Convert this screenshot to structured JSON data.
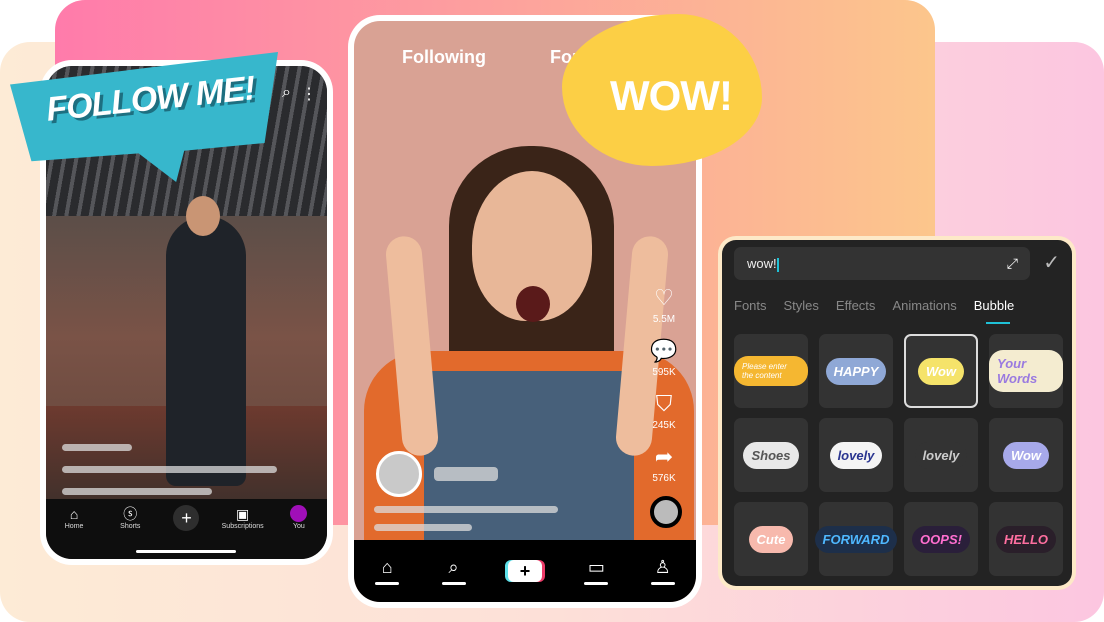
{
  "sticker_left": {
    "text": "FOLLOW ME!",
    "color": "#37b7cc"
  },
  "sticker_center": {
    "text": "WOW!",
    "color": "#fccf45"
  },
  "left_phone": {
    "nav": [
      {
        "label": "Home",
        "icon": "home-icon"
      },
      {
        "label": "Shorts",
        "icon": "shorts-icon"
      },
      {
        "label": "",
        "icon": "plus-icon"
      },
      {
        "label": "Subscriptions",
        "icon": "subscriptions-icon"
      },
      {
        "label": "You",
        "icon": "profile-icon"
      }
    ]
  },
  "center_phone": {
    "tabs": [
      "Following",
      "For"
    ],
    "actions": [
      {
        "icon": "heart-icon",
        "count": "5.5M"
      },
      {
        "icon": "comment-icon",
        "count": "595K"
      },
      {
        "icon": "bookmark-icon",
        "count": "245K"
      },
      {
        "icon": "share-icon",
        "count": "576K"
      }
    ],
    "nav": [
      "home-icon",
      "search-icon",
      "create-icon",
      "inbox-icon",
      "profile-icon"
    ]
  },
  "panel": {
    "input_value": "wow!",
    "tabs": [
      "Fonts",
      "Styles",
      "Effects",
      "Animations",
      "Bubble"
    ],
    "active_tab": "Bubble",
    "accent": "#1fc1d6",
    "bubbles": [
      {
        "text": "Please enter the content",
        "bg": "#f5b731",
        "fg": "#fff"
      },
      {
        "text": "HAPPY",
        "bg": "#8fa8d6",
        "fg": "#fff"
      },
      {
        "text": "Wow",
        "bg": "#f5e36a",
        "fg": "#fff",
        "selected": true
      },
      {
        "text": "Your Words",
        "bg": "#f4ecd0",
        "fg": "#9a7ae0"
      },
      {
        "text": "Shoes",
        "bg": "#e8e8e8",
        "fg": "#555"
      },
      {
        "text": "lovely",
        "bg": "#f4f4f4",
        "fg": "#2a3590"
      },
      {
        "text": "lovely",
        "bg": "#333",
        "fg": "#ccc"
      },
      {
        "text": "Wow",
        "bg": "#a7a9ea",
        "fg": "#fff"
      },
      {
        "text": "Cute",
        "bg": "#f7b9ad",
        "fg": "#fff"
      },
      {
        "text": "FORWARD",
        "bg": "#1d2f4a",
        "fg": "#4fb8ff"
      },
      {
        "text": "OOPS!",
        "bg": "#2a1f3a",
        "fg": "#ff6fd0"
      },
      {
        "text": "HELLO",
        "bg": "#2a1f2a",
        "fg": "#ff6fa0"
      }
    ]
  }
}
